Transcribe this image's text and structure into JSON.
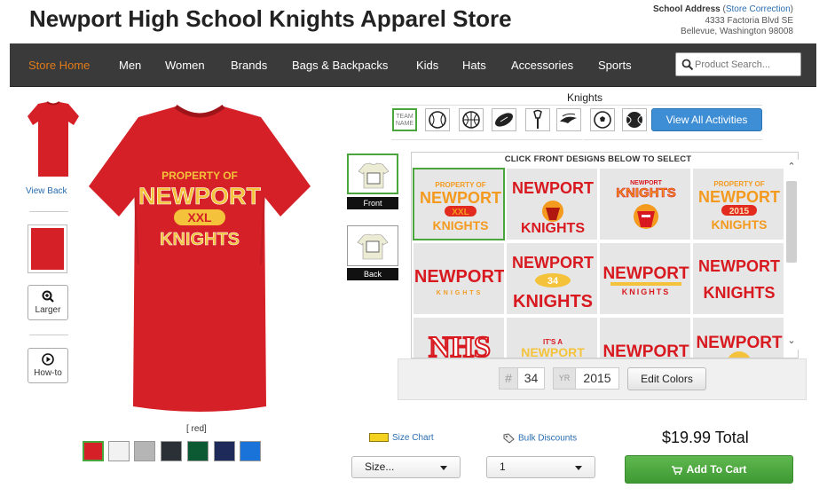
{
  "header": {
    "title": "Newport High School Knights Apparel Store",
    "address_label": "School Address",
    "correction_link": "Store Correction",
    "address_line1": "4333 Factoria Blvd SE",
    "address_line2": "Bellevue, Washington 98008"
  },
  "nav": {
    "items": [
      {
        "label": "Store Home",
        "active": true
      },
      {
        "label": "Men"
      },
      {
        "label": "Women"
      },
      {
        "label": "Brands"
      },
      {
        "label": "Bags & Backpacks"
      },
      {
        "label": "Kids"
      },
      {
        "label": "Hats"
      },
      {
        "label": "Accessories"
      },
      {
        "label": "Sports"
      }
    ],
    "search_placeholder": "Product Search..."
  },
  "thumbnails": {
    "view_back": "View Back",
    "larger": "Larger",
    "howto": "How-to"
  },
  "product": {
    "shirt_color": "#d42026",
    "design_lines": [
      "PROPERTY OF",
      "NEWPORT",
      "XXL",
      "KNIGHTS"
    ],
    "color_caption": "[ red]",
    "swatches": [
      "#d42026",
      "#f2f2f2",
      "#b5b5b5",
      "#2b2f36",
      "#0b5a33",
      "#1e2a5a",
      "#1a73d9"
    ],
    "selected_swatch": 0
  },
  "activities": {
    "label": "Knights",
    "team_name_icon": "TEAM NAME",
    "icons": [
      "team-name-icon",
      "baseball-icon",
      "basketball-icon",
      "football-icon",
      "lacrosse-icon",
      "track-icon",
      "soccer-icon",
      "tennis-icon"
    ],
    "view_all": "View All Activities"
  },
  "sides": {
    "front": "Front",
    "back": "Back"
  },
  "designs": {
    "header": "CLICK FRONT DESIGNS BELOW TO SELECT",
    "cells": [
      {
        "top": "PROPERTY OF",
        "main": "NEWPORT",
        "badge": "XXL",
        "bottom": "KNIGHTS",
        "style": "gold"
      },
      {
        "top": "",
        "main": "NEWPORT",
        "badge": "",
        "bottom": "KNIGHTS",
        "style": "red-mascot"
      },
      {
        "top": "NEWPORT",
        "main": "KNIGHTS",
        "badge": "",
        "bottom": "",
        "style": "mascot"
      },
      {
        "top": "PROPERTY OF",
        "main": "NEWPORT",
        "badge": "2015",
        "bottom": "KNIGHTS",
        "style": "gold"
      },
      {
        "top": "",
        "main": "NEWPORT",
        "badge": "",
        "bottom": "KNIGHTS",
        "style": "red-small"
      },
      {
        "top": "",
        "main": "NEWPORT",
        "badge": "34",
        "bottom": "KNIGHTS",
        "style": "red-num"
      },
      {
        "top": "",
        "main": "NEWPORT",
        "badge": "",
        "bottom": "KNIGHTS",
        "style": "red-bar"
      },
      {
        "top": "",
        "main": "NEWPORT",
        "badge": "",
        "bottom": "KNIGHTS",
        "style": "red-arc"
      },
      {
        "top": "",
        "main": "NHS",
        "badge": "",
        "bottom": "",
        "style": "outline"
      },
      {
        "top": "IT'S A",
        "main": "NEWPORT",
        "badge": "",
        "bottom": "",
        "style": "thing"
      },
      {
        "top": "",
        "main": "NEWPORT",
        "badge": "",
        "bottom": "",
        "style": "red-arc"
      },
      {
        "top": "",
        "main": "NEWPORT",
        "badge": "",
        "bottom": "",
        "style": "red-plain"
      }
    ]
  },
  "editor": {
    "number_prefix": "#",
    "number_value": "34",
    "year_prefix": "YR",
    "year_value": "2015",
    "edit_colors": "Edit Colors"
  },
  "purchase": {
    "size_chart": "Size Chart",
    "bulk_discounts": "Bulk Discounts",
    "price": "$19.99 Total",
    "size_value": "Size...",
    "qty_value": "1",
    "add_to_cart": "Add To Cart"
  }
}
